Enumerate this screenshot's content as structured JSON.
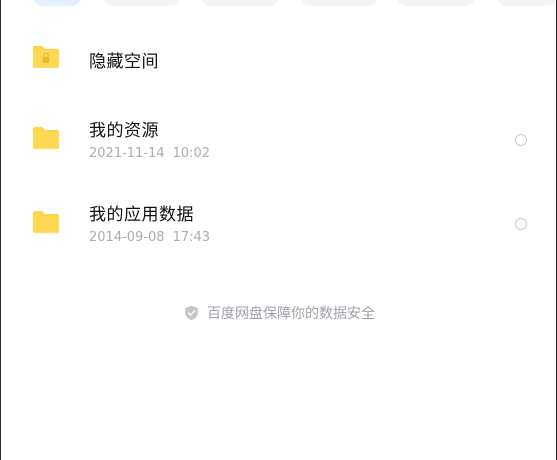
{
  "tabs": [
    {
      "label": "",
      "active": true
    },
    {
      "label": "",
      "active": false
    },
    {
      "label": "",
      "active": false
    },
    {
      "label": "",
      "active": false
    },
    {
      "label": "",
      "active": false
    },
    {
      "label": "",
      "active": false
    }
  ],
  "files": [
    {
      "name": "隐藏空间",
      "date": "",
      "time": "",
      "icon": "locked-folder-icon",
      "selectable": false
    },
    {
      "name": "我的资源",
      "date": "2021-11-14",
      "time": "10:02",
      "icon": "folder-icon",
      "selectable": true
    },
    {
      "name": "我的应用数据",
      "date": "2014-09-08",
      "time": "17:43",
      "icon": "folder-icon",
      "selectable": true
    }
  ],
  "footer": {
    "icon": "shield-icon",
    "text": "百度网盘保障你的数据安全"
  },
  "colors": {
    "folder": "#fdd44b",
    "folder_tab": "#f7c536",
    "title_text": "#111111",
    "meta_text": "#a9adb4",
    "radio_border": "#c8cbd0",
    "footer_text": "#9ea2a8",
    "active_chip_bg": "#e3f0ff"
  }
}
